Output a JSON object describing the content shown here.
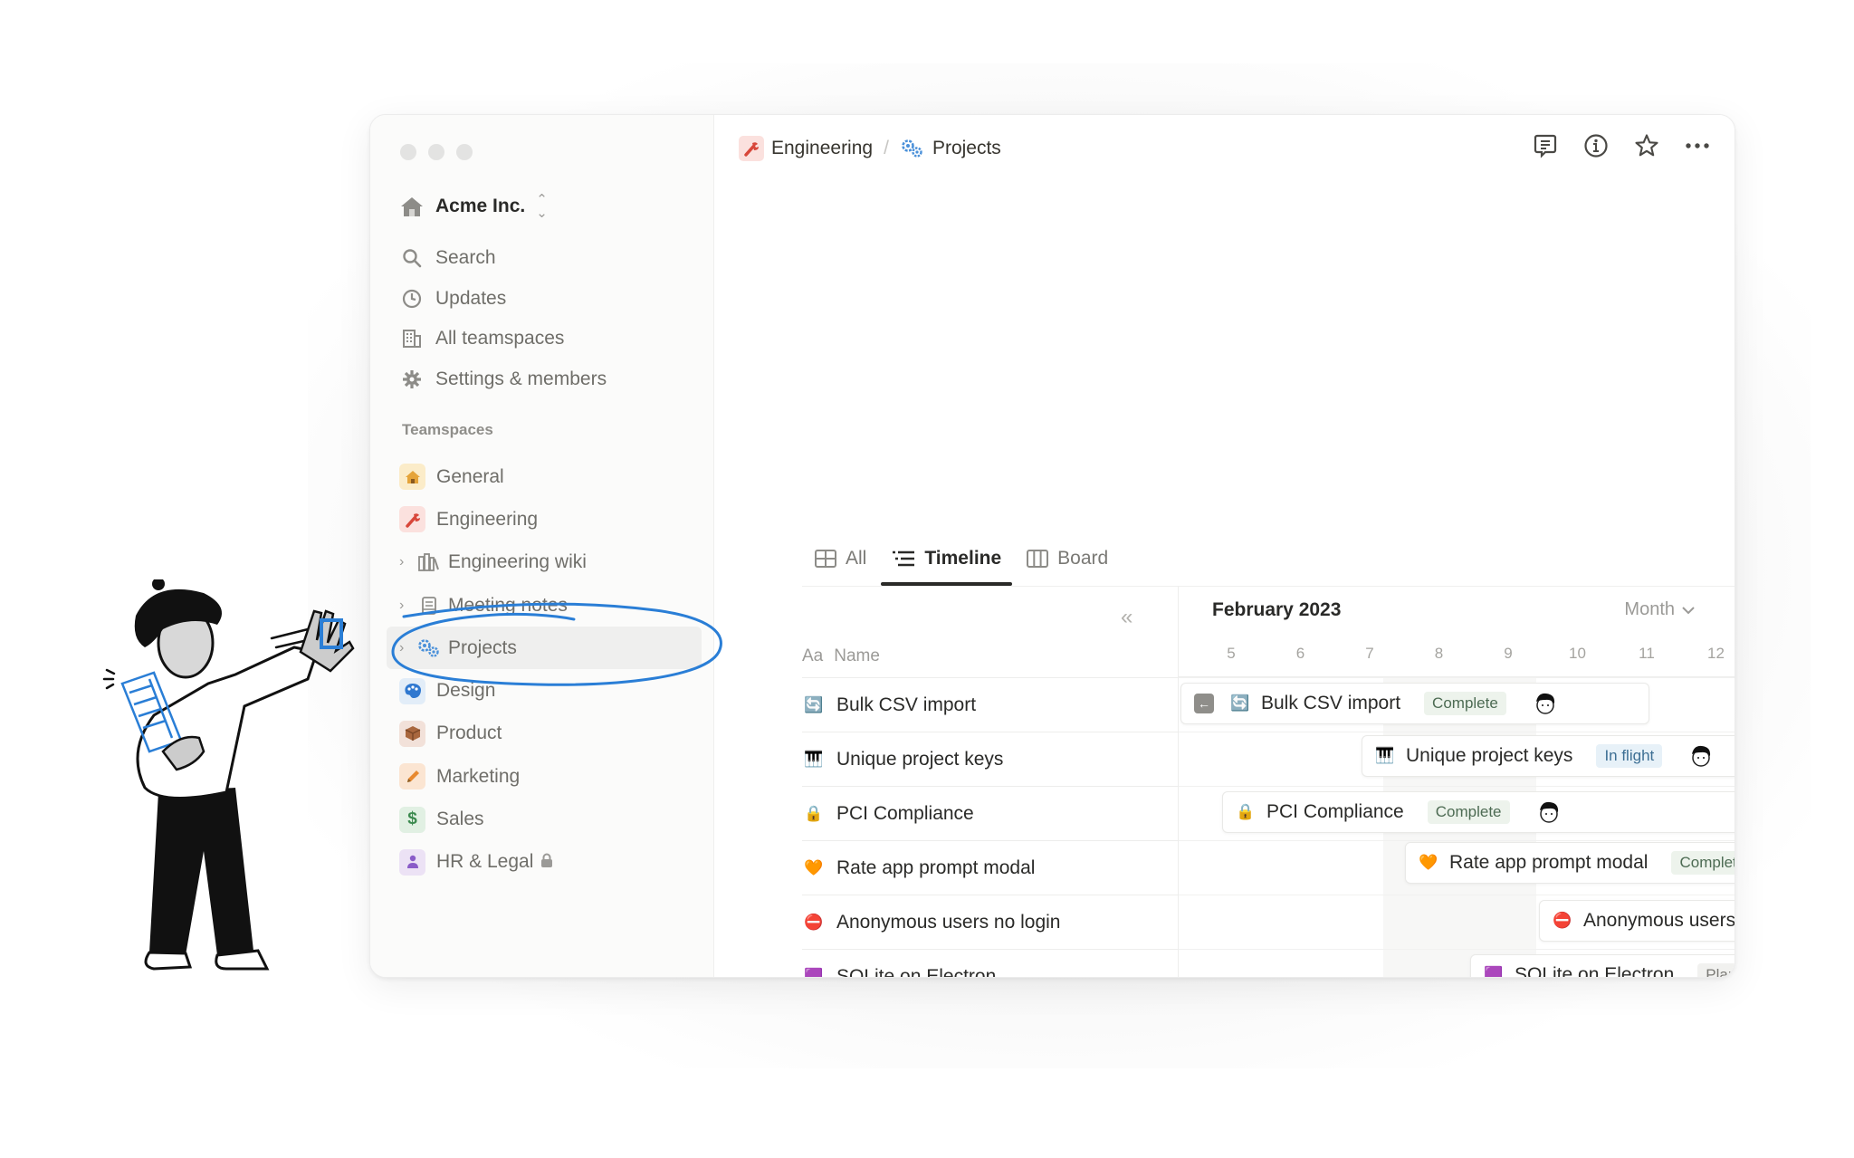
{
  "window": {
    "traffic_lights": [
      "close",
      "minimize",
      "maximize"
    ]
  },
  "sidebar": {
    "workspace": {
      "name": "Acme Inc.",
      "icon": "house-icon",
      "switcher_icon": "chevron-up-down-icon"
    },
    "nav": [
      {
        "label": "Search",
        "icon": "search-icon"
      },
      {
        "label": "Updates",
        "icon": "clock-icon"
      },
      {
        "label": "All teamspaces",
        "icon": "building-icon"
      },
      {
        "label": "Settings & members",
        "icon": "gear-icon"
      }
    ],
    "section_label": "Teamspaces",
    "teamspaces": [
      {
        "label": "General",
        "icon": "house-icon",
        "color": "#fbecc9"
      },
      {
        "label": "Engineering",
        "icon": "wrench-icon",
        "color": "#fbe1de"
      },
      {
        "label": "Engineering wiki",
        "icon": "books-icon",
        "sub": true
      },
      {
        "label": "Meeting notes",
        "icon": "notebook-icon",
        "sub": true
      },
      {
        "label": "Projects",
        "icon": "gears-icon",
        "sub": true,
        "active": true
      },
      {
        "label": "Design",
        "icon": "palette-icon",
        "color": "#e2edf8"
      },
      {
        "label": "Product",
        "icon": "package-icon",
        "color": "#f2e1d9"
      },
      {
        "label": "Marketing",
        "icon": "pencil-icon",
        "color": "#fbe5d2"
      },
      {
        "label": "Sales",
        "icon": "dollar-icon",
        "color": "#e1f0e3"
      },
      {
        "label": "HR & Legal",
        "icon": "person-icon",
        "color": "#ece2f5",
        "locked": true
      }
    ]
  },
  "header": {
    "breadcrumb": [
      {
        "label": "Engineering",
        "icon": "wrench-icon"
      },
      {
        "label": "Projects",
        "icon": "gears-icon"
      }
    ],
    "separator": "/",
    "actions": [
      "comments-icon",
      "info-icon",
      "star-icon",
      "more-icon"
    ]
  },
  "views": {
    "tabs": [
      {
        "label": "All",
        "icon": "table-icon"
      },
      {
        "label": "Timeline",
        "icon": "timeline-icon",
        "active": true
      },
      {
        "label": "Board",
        "icon": "board-icon"
      }
    ]
  },
  "table": {
    "collapse_icon": "«",
    "column_prefix": "Aa",
    "column_name": "Name",
    "rows": [
      {
        "name": "Bulk CSV import",
        "icon": "refresh-icon",
        "glyph": "🔄"
      },
      {
        "name": "Unique project keys",
        "icon": "piano-icon",
        "glyph": "🎹"
      },
      {
        "name": "PCI Compliance",
        "icon": "lock-icon",
        "glyph": "🔒"
      },
      {
        "name": "Rate app prompt modal",
        "icon": "heart-icon",
        "glyph": "🧡"
      },
      {
        "name": "Anonymous users no login",
        "icon": "no-entry-icon",
        "glyph": "⛔"
      },
      {
        "name": "SQLite on Electron",
        "icon": "database-icon",
        "glyph": "🟪"
      }
    ]
  },
  "timeline": {
    "month": "February 2023",
    "scale": "Month",
    "days": [
      "5",
      "6",
      "7",
      "8",
      "9",
      "10",
      "11",
      "12"
    ],
    "items": [
      {
        "name": "Bulk CSV import",
        "glyph": "🔄",
        "status": "Complete",
        "status_kind": "complete",
        "has_back_arrow": true,
        "avatar": true
      },
      {
        "name": "Unique project keys",
        "glyph": "🎹",
        "status": "In flight",
        "status_kind": "inflight",
        "avatar": true
      },
      {
        "name": "PCI Compliance",
        "glyph": "🔒",
        "status": "Complete",
        "status_kind": "complete",
        "avatar": true
      },
      {
        "name": "Rate app prompt modal",
        "glyph": "🧡",
        "status": "Complete",
        "status_kind": "complete"
      },
      {
        "name": "Anonymous users no login",
        "glyph": "⛔"
      },
      {
        "name": "SQLite on Electron",
        "glyph": "🟪",
        "status": "Planning",
        "status_kind": "planning"
      }
    ]
  }
}
